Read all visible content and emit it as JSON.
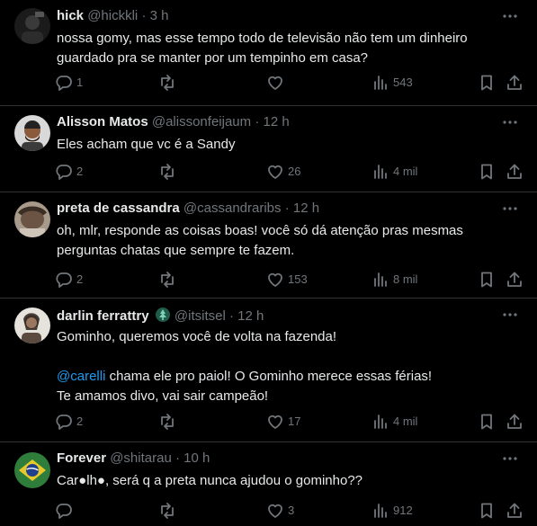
{
  "tweets": [
    {
      "name": "hick",
      "handle": "@hickkli",
      "time": "3 h",
      "lines": [
        "nossa gomy, mas esse tempo todo de televisão não tem um dinheiro",
        "guardado pra se manter por um tempinho em casa?"
      ],
      "reply_count": "1",
      "retweet_count": "",
      "like_count": "",
      "view_count": "543"
    },
    {
      "name": "Alisson Matos",
      "handle": "@alissonfeijaum",
      "time": "12 h",
      "lines": [
        "Eles acham que vc é a Sandy"
      ],
      "reply_count": "2",
      "retweet_count": "",
      "like_count": "26",
      "view_count": "4 mil"
    },
    {
      "name": "preta de cassandra",
      "handle": "@cassandraribs",
      "time": "12 h",
      "lines": [
        "oh, mlr, responde as coisas boas! você só dá atenção pras mesmas",
        "perguntas chatas que sempre te fazem."
      ],
      "reply_count": "2",
      "retweet_count": "",
      "like_count": "153",
      "view_count": "8 mil"
    },
    {
      "name": "darlin ferrattry",
      "handle": "@itsitsel",
      "time": "12 h",
      "line1": "Gominho, queremos você de volta na fazenda!",
      "mention": "@carelli",
      "line2": " chama ele pro paiol! O Gominho merece essas férias!",
      "line3": "Te amamos divo, vai sair campeão!",
      "reply_count": "2",
      "retweet_count": "",
      "like_count": "17",
      "view_count": "4 mil"
    },
    {
      "name": "Forever",
      "handle": "@shitarau",
      "time": "10 h",
      "lines": [
        "Car●lh●, será q a preta nunca ajudou o gominho??"
      ],
      "reply_count": "",
      "retweet_count": "",
      "like_count": "3",
      "view_count": "912"
    }
  ],
  "separator": "·",
  "colors": {
    "background": "#000000",
    "text": "#e7e9ea",
    "muted": "#71767b",
    "link": "#1d9bf0",
    "divider": "#2f3336"
  },
  "icons": [
    "more-icon",
    "reply-icon",
    "retweet-icon",
    "like-icon",
    "views-icon",
    "bookmark-icon",
    "share-icon",
    "badge-icon"
  ]
}
